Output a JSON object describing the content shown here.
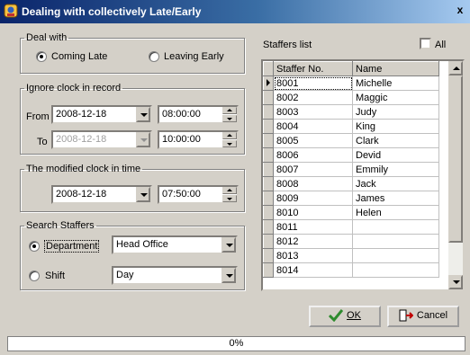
{
  "window": {
    "title": "Dealing with collectively Late/Early",
    "close_label": "x"
  },
  "deal_with": {
    "legend": "Deal with",
    "coming_late": {
      "label": "Coming Late",
      "checked": true
    },
    "leaving_early": {
      "label": "Leaving Early",
      "checked": false
    }
  },
  "ignore_clock": {
    "legend": "Ignore clock in record",
    "from_label": "From",
    "from_date": "2008-12-18",
    "from_time": "08:00:00",
    "to_label": "To",
    "to_date": "2008-12-18",
    "to_time": "10:00:00"
  },
  "modified_clock": {
    "legend": "The modified clock in time",
    "date": "2008-12-18",
    "time": "07:50:00"
  },
  "search": {
    "legend": "Search Staffers",
    "department": {
      "label": "Department",
      "checked": true,
      "value": "Head Office"
    },
    "shift": {
      "label": "Shift",
      "checked": false,
      "value": "Day"
    }
  },
  "staffers": {
    "label": "Staffers list",
    "all_label": "All",
    "columns": [
      "Staffer No.",
      "Name"
    ],
    "rows": [
      [
        "8001",
        "Michelle"
      ],
      [
        "8002",
        "Maggic"
      ],
      [
        "8003",
        "Judy"
      ],
      [
        "8004",
        "King"
      ],
      [
        "8005",
        "Clark"
      ],
      [
        "8006",
        "Devid"
      ],
      [
        "8007",
        "Emmily"
      ],
      [
        "8008",
        "Jack"
      ],
      [
        "8009",
        "James"
      ],
      [
        "8010",
        "Helen"
      ],
      [
        "8011",
        ""
      ],
      [
        "8012",
        ""
      ],
      [
        "8013",
        ""
      ],
      [
        "8014",
        ""
      ]
    ]
  },
  "buttons": {
    "ok": "OK",
    "cancel": "Cancel"
  },
  "progress": {
    "value": 0,
    "text": "0%"
  }
}
